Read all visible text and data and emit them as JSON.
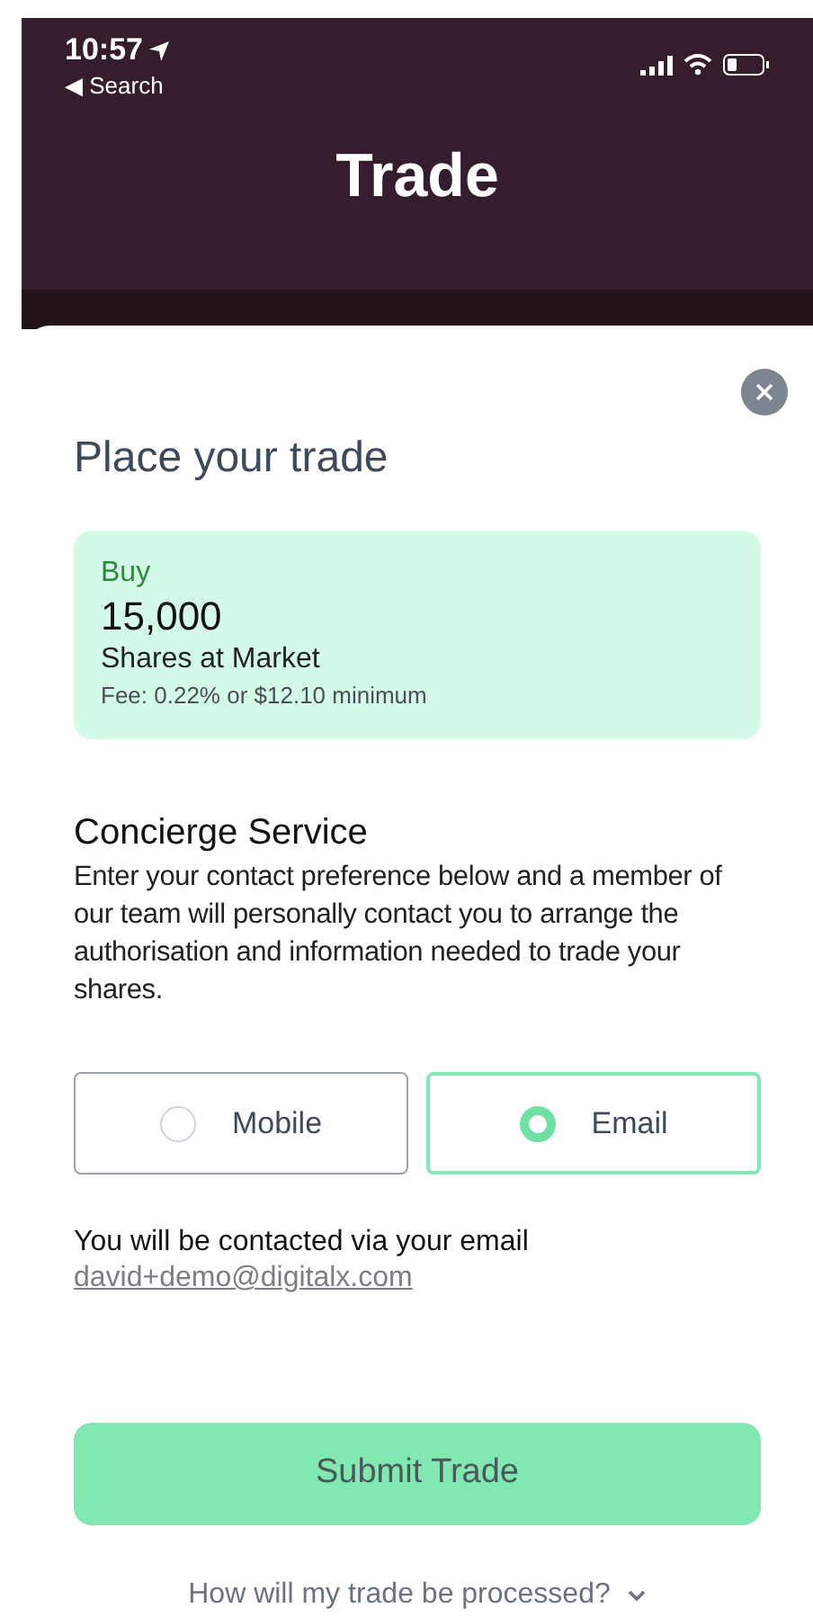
{
  "status_bar": {
    "time": "10:57",
    "back_label": "◀ Search"
  },
  "header": {
    "title": "Trade"
  },
  "sheet": {
    "title": "Place your trade",
    "order": {
      "side": "Buy",
      "quantity": "15,000",
      "description": "Shares at Market",
      "fee": "Fee: 0.22% or $12.10 minimum"
    },
    "concierge": {
      "heading": "Concierge Service",
      "description": "Enter your contact preference below and a member of our team will personally contact you to arrange the authorisation and information needed to trade your shares."
    },
    "contact_options": [
      {
        "label": "Mobile",
        "selected": false
      },
      {
        "label": "Email",
        "selected": true
      }
    ],
    "contact_note": "You will be contacted via your email",
    "email": "david+demo@digitalx.com",
    "submit_label": "Submit Trade",
    "help_link": "How will my trade be processed?"
  }
}
